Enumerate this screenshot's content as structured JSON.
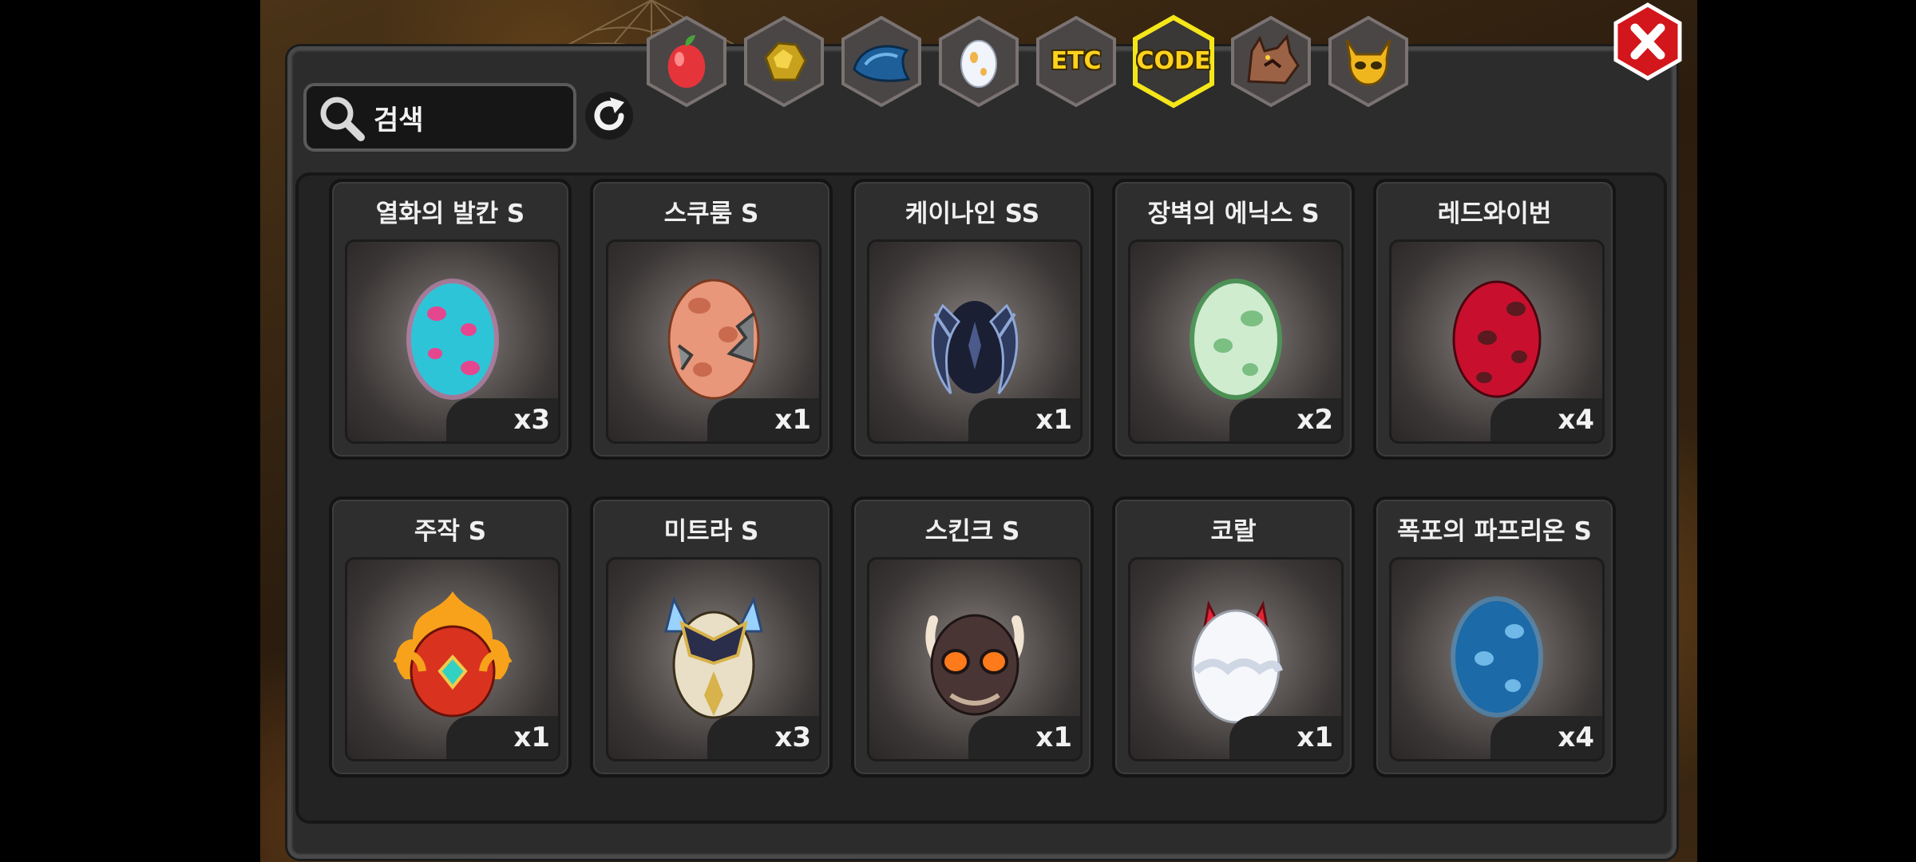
{
  "tabs": [
    {
      "icon": "fruit-icon",
      "label": ""
    },
    {
      "icon": "gold-ore-icon",
      "label": ""
    },
    {
      "icon": "blue-scale-icon",
      "label": ""
    },
    {
      "icon": "egg-icon",
      "label": ""
    },
    {
      "icon": "etc-icon",
      "label": "ETC"
    },
    {
      "icon": "code-icon",
      "label": "CODE",
      "selected": true
    },
    {
      "icon": "werewolf-icon",
      "label": ""
    },
    {
      "icon": "horned-mask-icon",
      "label": ""
    }
  ],
  "search": {
    "placeholder": "검색"
  },
  "highlight_color": "#f5e61a",
  "items": [
    {
      "name": "열화의 발칸 S",
      "qty": "x3",
      "icon": "cyan-pink-spotted-egg"
    },
    {
      "name": "스쿠룸 S",
      "qty": "x1",
      "icon": "cracked-orange-egg"
    },
    {
      "name": "케이나인 SS",
      "qty": "x1",
      "icon": "dark-spiked-egg"
    },
    {
      "name": "장벽의 에닉스 S",
      "qty": "x2",
      "icon": "green-spotted-egg"
    },
    {
      "name": "레드와이번",
      "qty": "x4",
      "icon": "red-spotted-egg"
    },
    {
      "name": "주작 S",
      "qty": "x1",
      "icon": "fire-phoenix-egg"
    },
    {
      "name": "미트라 S",
      "qty": "x3",
      "icon": "armored-winged-egg"
    },
    {
      "name": "스킨크 S",
      "qty": "x1",
      "icon": "dark-horned-egg"
    },
    {
      "name": "코랄",
      "qty": "x1",
      "icon": "white-red-horned-egg"
    },
    {
      "name": "폭포의 파프리온 S",
      "qty": "x4",
      "icon": "blue-spotted-egg"
    }
  ]
}
